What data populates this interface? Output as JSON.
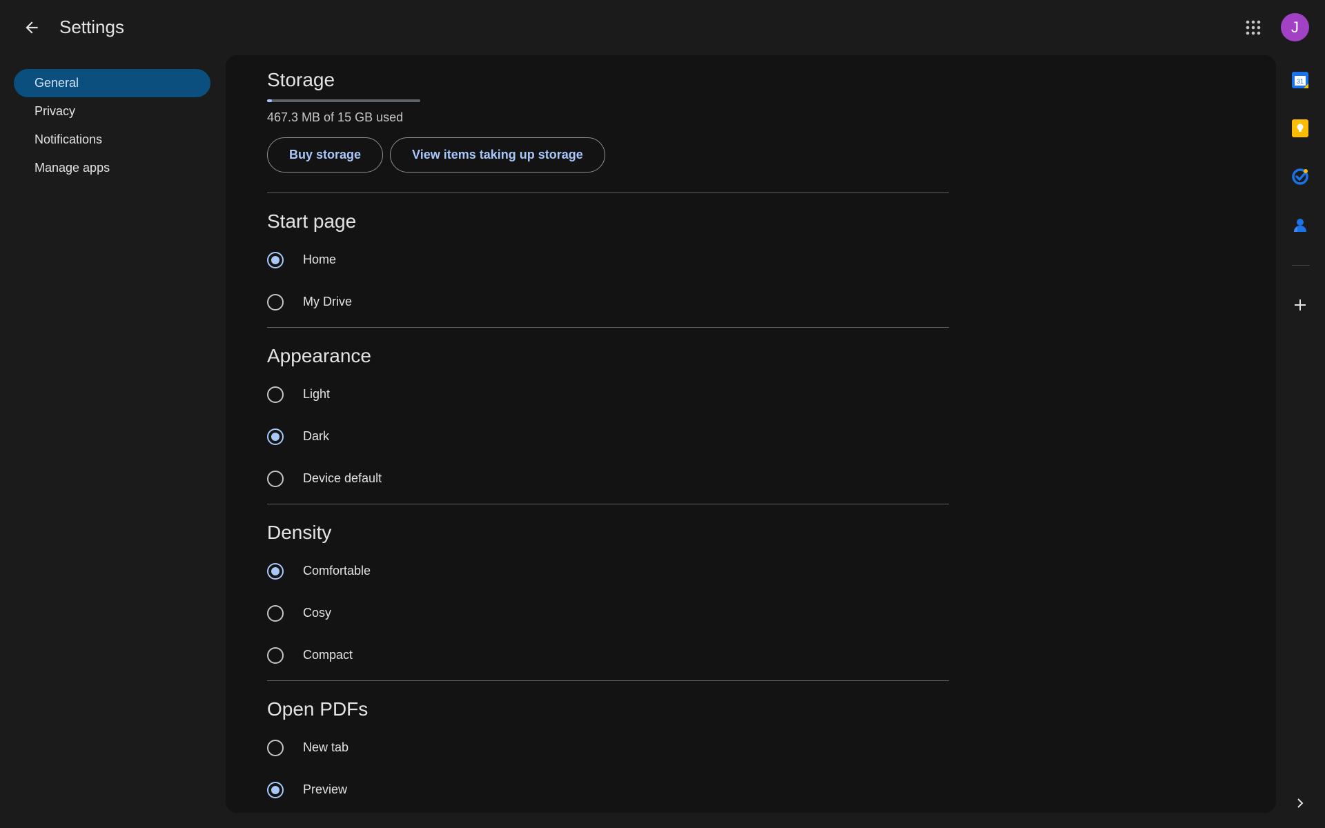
{
  "header": {
    "title": "Settings",
    "avatar_initial": "J"
  },
  "sidebar": {
    "items": [
      {
        "label": "General",
        "active": true
      },
      {
        "label": "Privacy"
      },
      {
        "label": "Notifications"
      },
      {
        "label": "Manage apps"
      }
    ]
  },
  "storage": {
    "title": "Storage",
    "used_fraction": 0.03,
    "usage_text": "467.3 MB of 15 GB used",
    "buy_label": "Buy storage",
    "view_label": "View items taking up storage"
  },
  "start_page": {
    "title": "Start page",
    "options": [
      {
        "label": "Home",
        "checked": true
      },
      {
        "label": "My Drive",
        "checked": false
      }
    ]
  },
  "appearance": {
    "title": "Appearance",
    "options": [
      {
        "label": "Light",
        "checked": false
      },
      {
        "label": "Dark",
        "checked": true
      },
      {
        "label": "Device default",
        "checked": false
      }
    ]
  },
  "density": {
    "title": "Density",
    "options": [
      {
        "label": "Comfortable",
        "checked": true
      },
      {
        "label": "Cosy",
        "checked": false
      },
      {
        "label": "Compact",
        "checked": false
      }
    ]
  },
  "open_pdfs": {
    "title": "Open PDFs",
    "options": [
      {
        "label": "New tab",
        "checked": false
      },
      {
        "label": "Preview",
        "checked": true
      }
    ]
  },
  "right_rail": {
    "icons": [
      "calendar-icon",
      "keep-icon",
      "tasks-icon",
      "contacts-icon",
      "add-icon",
      "chevron-right-icon"
    ],
    "calendar_day": "31"
  },
  "colors": {
    "accent": "#a8c7fa",
    "active_nav": "#0a4f7d",
    "avatar": "#a142c5",
    "calendar": "#1a73e8",
    "keep": "#fbbc04",
    "tasks": "#1a73e8",
    "contacts": "#1a73e8"
  }
}
